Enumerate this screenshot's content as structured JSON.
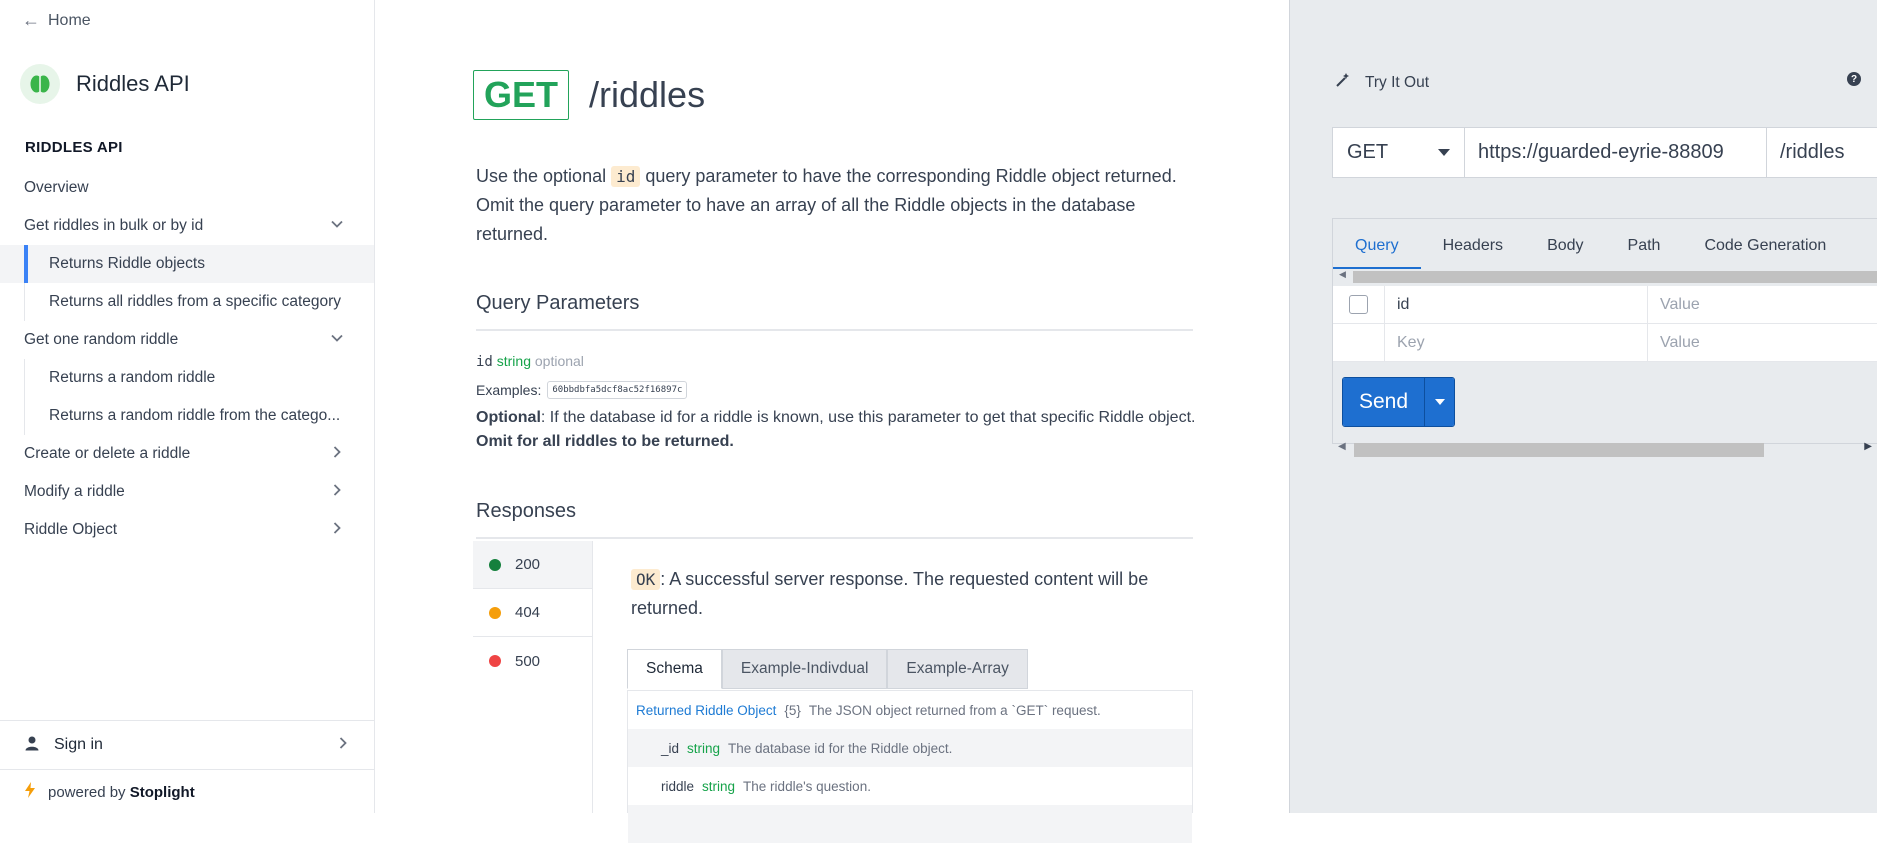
{
  "sidebar": {
    "home_label": "Home",
    "brand_name": "Riddles API",
    "section_title": "RIDDLES API",
    "items": [
      {
        "label": "Overview"
      },
      {
        "label": "Get riddles in bulk or by id"
      },
      {
        "label": "Returns Riddle objects"
      },
      {
        "label": "Returns all riddles from a specific category"
      },
      {
        "label": "Get one random riddle"
      },
      {
        "label": "Returns a random riddle"
      },
      {
        "label": "Returns a random riddle from the catego..."
      },
      {
        "label": "Create or delete a riddle"
      },
      {
        "label": "Modify a riddle"
      },
      {
        "label": "Riddle Object"
      }
    ],
    "sign_in_label": "Sign in",
    "powered_prefix": "powered by",
    "powered_brand": "Stoplight",
    "brand_color": "#3ab54a"
  },
  "main": {
    "method": "GET",
    "path": "/riddles",
    "desc_part1": "Use the optional",
    "desc_code": "id",
    "desc_part2": "query parameter to have the corresponding Riddle object returned. Omit the query parameter to have an array of all the Riddle objects in the database returned.",
    "query_params_heading": "Query Parameters",
    "param_name": "id",
    "param_type": "string",
    "param_optional": "optional",
    "examples_label": "Examples:",
    "example_value": "60bbdbfa5dcf8ac52f16897c",
    "param_desc_bold": "Optional",
    "param_desc_text": ": If the database id for a riddle is known, use this parameter to get that specific Riddle object.",
    "param_desc_bold2": "Omit for all riddles to be returned.",
    "responses_heading": "Responses",
    "response_codes": [
      {
        "code": "200",
        "color": "#15803d"
      },
      {
        "code": "404",
        "color": "#f59e0b"
      },
      {
        "code": "500",
        "color": "#ef4444"
      }
    ],
    "response_code_badge": "OK",
    "response_text": ": A successful server response. The requested content will be returned.",
    "response_tabs": [
      "Schema",
      "Example-Indivdual",
      "Example-Array"
    ],
    "schema": {
      "root_name": "Returned Riddle Object",
      "root_count": "{5}",
      "root_desc": "The JSON object returned from a `GET` request.",
      "fields": [
        {
          "name": "_id",
          "type": "string",
          "desc": "The database id for the Riddle object."
        },
        {
          "name": "riddle",
          "type": "string",
          "desc": "The riddle's question."
        }
      ]
    }
  },
  "panel": {
    "try_label": "Try It Out",
    "help_icon": "?",
    "method": "GET",
    "url": "https://guarded-eyrie-88809",
    "url_path": "/riddles",
    "tabs": [
      "Query",
      "Headers",
      "Body",
      "Path",
      "Code Generation"
    ],
    "rows": [
      {
        "key": "id",
        "value_placeholder": "Value"
      },
      {
        "key_placeholder": "Key",
        "value_placeholder": "Value"
      }
    ],
    "send_label": "Send",
    "accent_color": "#1e6fd0"
  }
}
